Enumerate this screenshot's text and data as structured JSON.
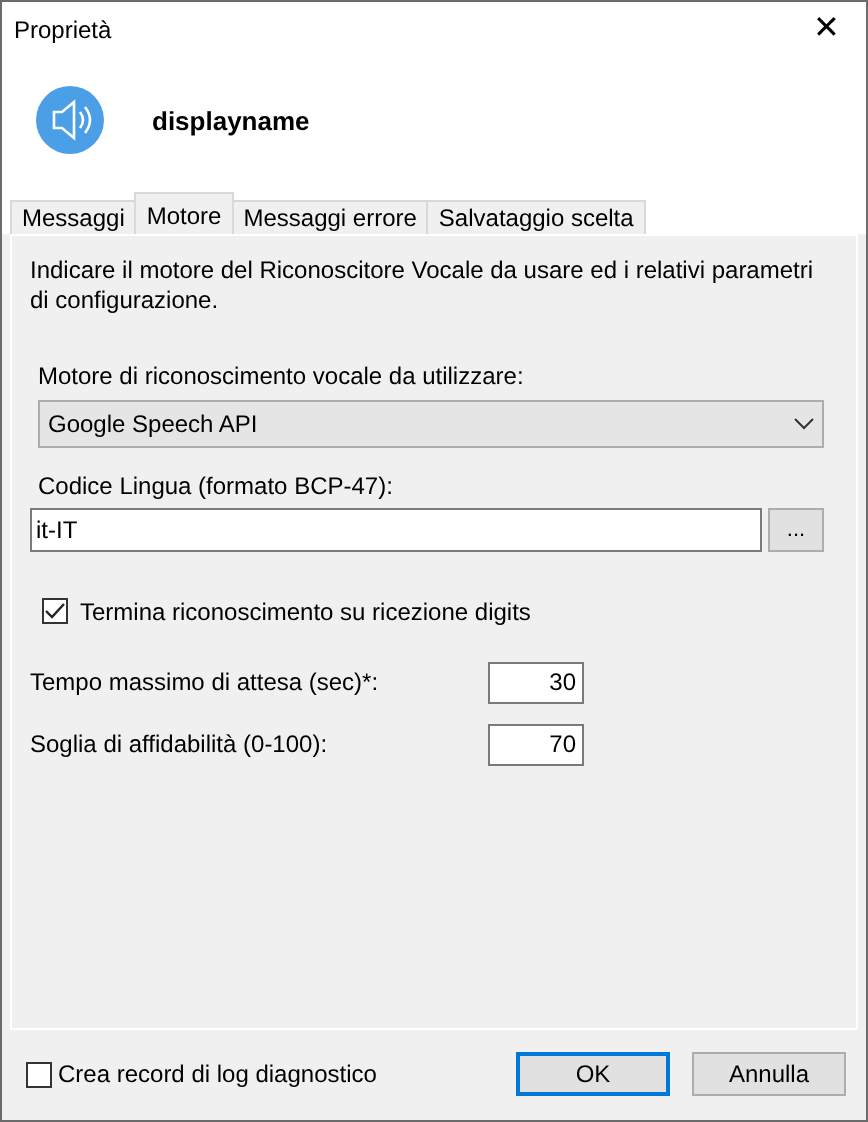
{
  "window": {
    "title": "Proprietà",
    "close": "✕"
  },
  "header": {
    "name": "displayname"
  },
  "tabs": [
    {
      "label": "Messaggi",
      "selected": false
    },
    {
      "label": "Motore",
      "selected": true
    },
    {
      "label": "Messaggi errore",
      "selected": false
    },
    {
      "label": "Salvataggio scelta",
      "selected": false
    }
  ],
  "panel": {
    "description": "Indicare il motore del Riconoscitore Vocale da usare ed i relativi parametri di configurazione.",
    "engine": {
      "label": "Motore di riconoscimento vocale da utilizzare:",
      "value": "Google Speech API"
    },
    "language": {
      "label": "Codice Lingua (formato BCP-47):",
      "value": "it-IT",
      "browse": "..."
    },
    "stop_on_digits": {
      "label": "Termina riconoscimento su ricezione digits",
      "checked": true
    },
    "numbers": [
      {
        "label": "Tempo massimo di attesa (sec)*:",
        "value": "30"
      },
      {
        "label": "Soglia di affidabilità (0-100):",
        "value": "70"
      }
    ]
  },
  "footer": {
    "log": {
      "label": "Crea record di log diagnostico",
      "checked": false
    },
    "buttons": [
      {
        "label": "OK",
        "default": true
      },
      {
        "label": "Annulla",
        "default": false
      }
    ]
  }
}
